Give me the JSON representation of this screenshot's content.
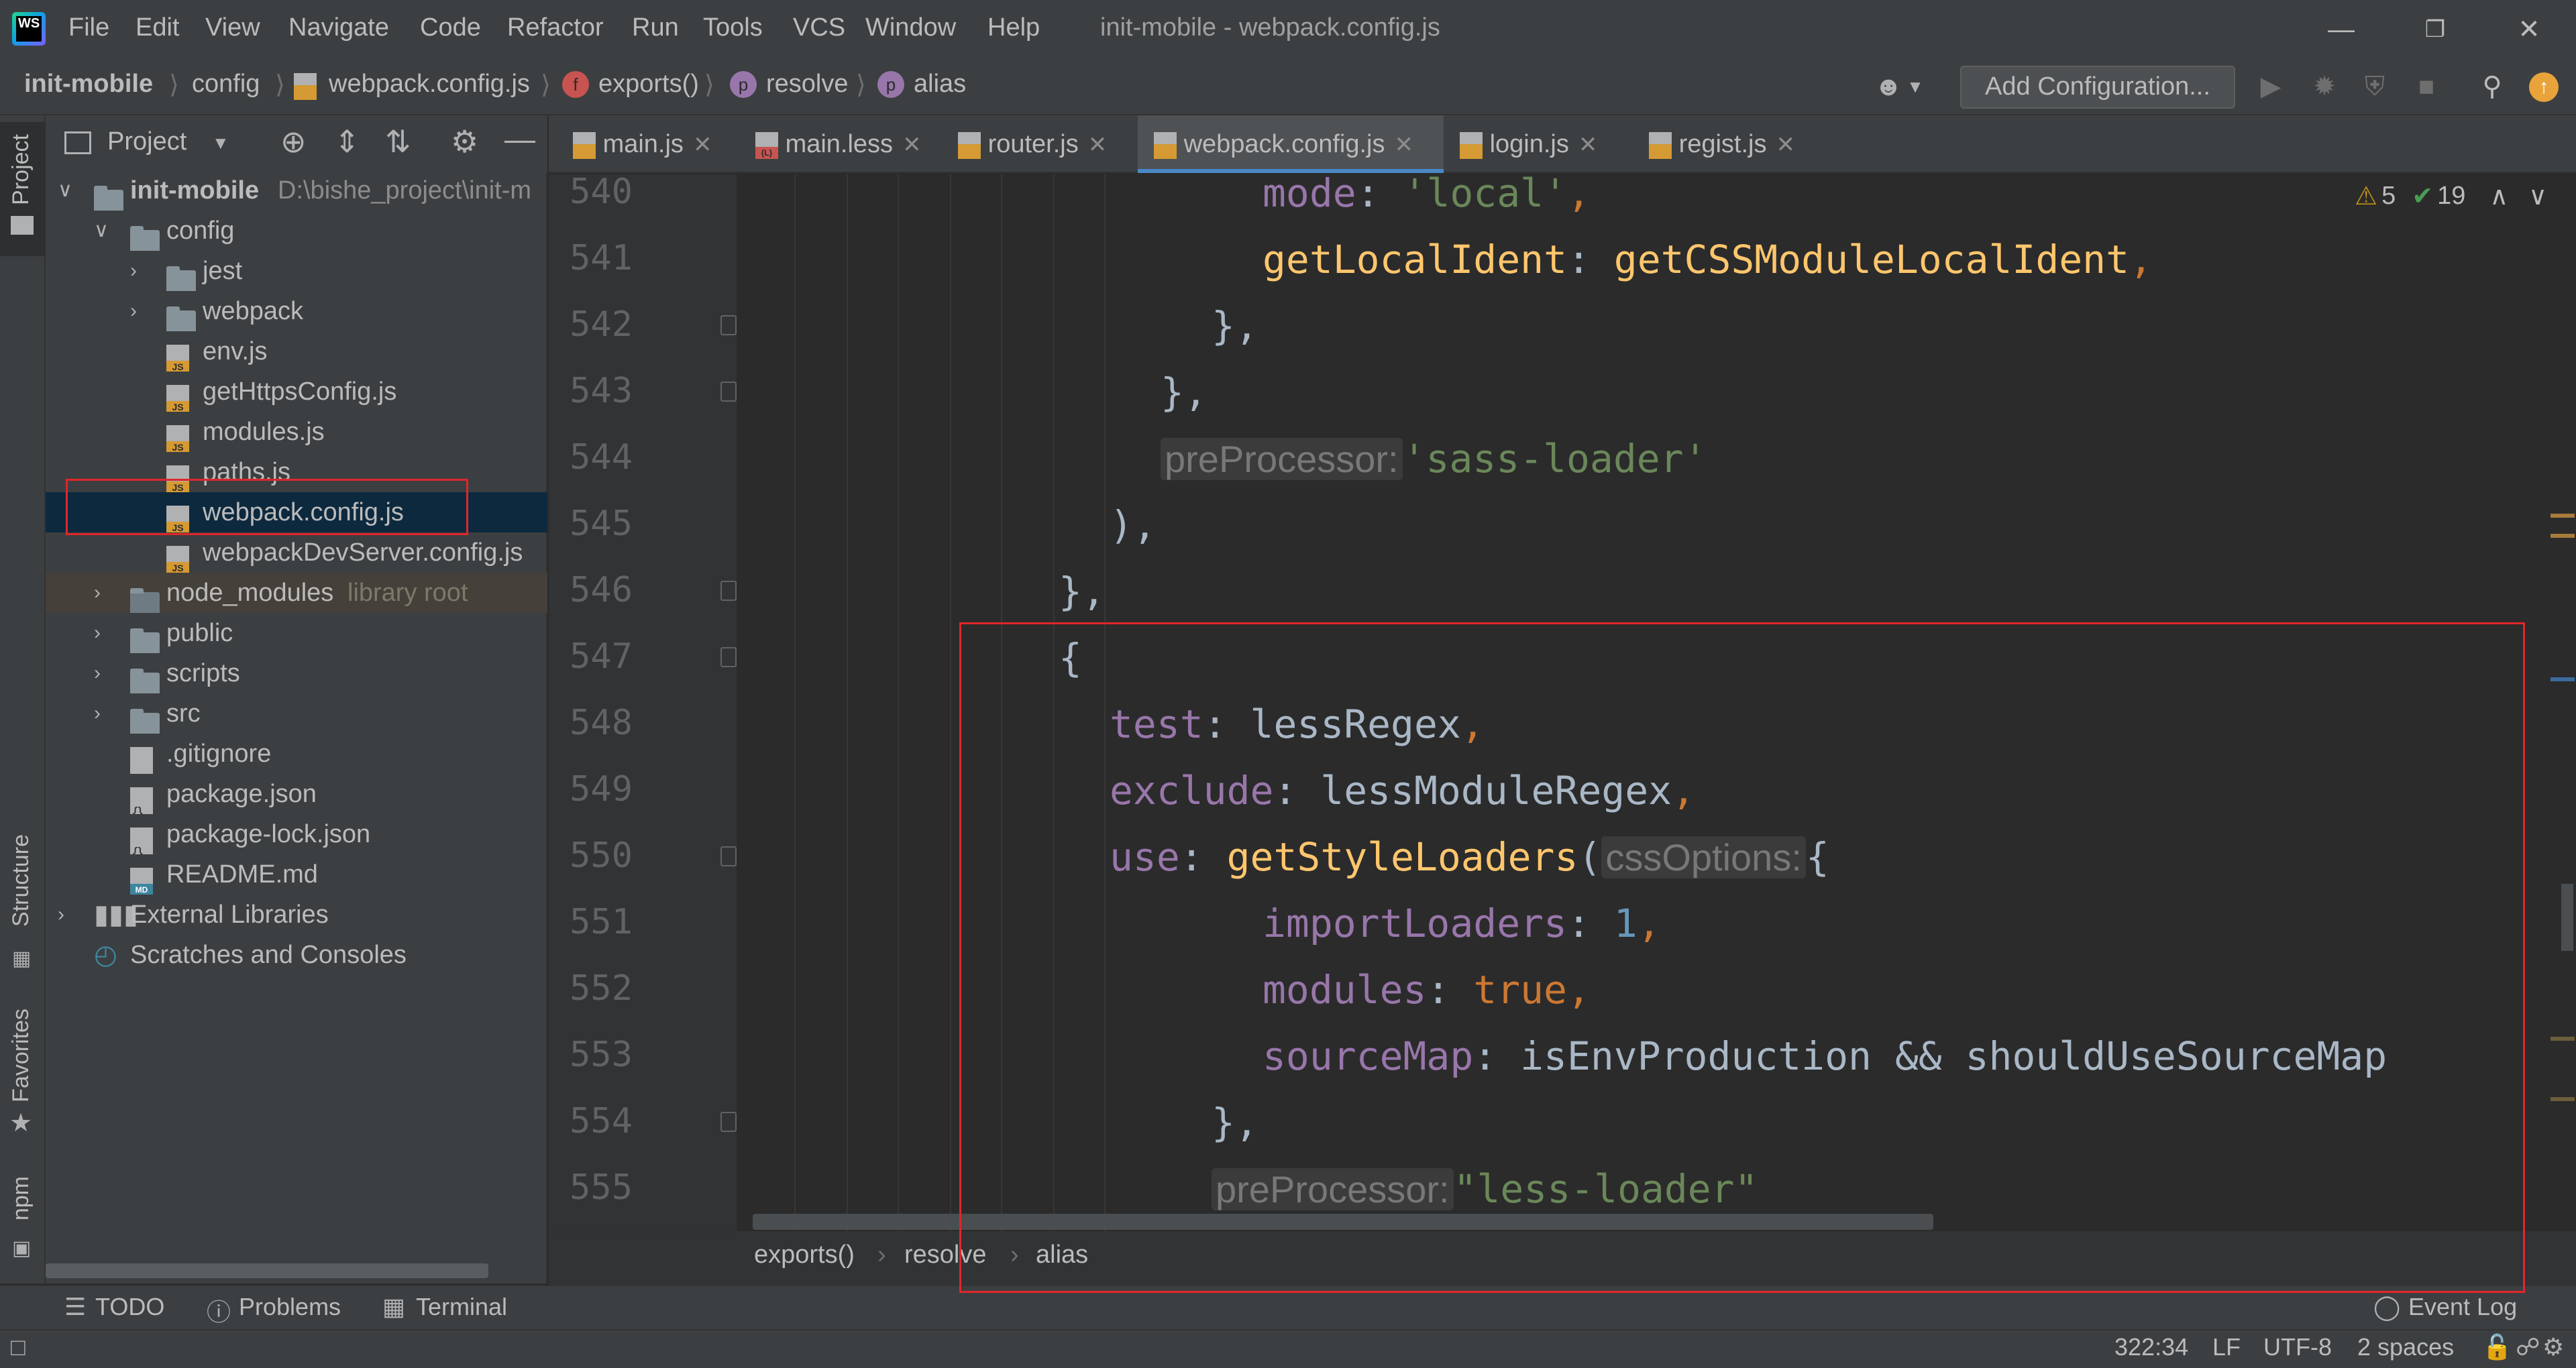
{
  "colors": {
    "accent": "#4A88C7",
    "annotation": "#E0262B",
    "keyword": "#CC7832",
    "property": "#9876AA",
    "string": "#6A8759",
    "function": "#FFC66D",
    "number": "#6897BB"
  },
  "menubar": {
    "items": [
      "File",
      "Edit",
      "View",
      "Navigate",
      "Code",
      "Refactor",
      "Run",
      "Tools",
      "VCS",
      "Window",
      "Help"
    ],
    "window_title": "init-mobile - webpack.config.js",
    "logo_text": "WS"
  },
  "navbar": {
    "crumbs": [
      "init-mobile",
      "config",
      "webpack.config.js",
      "exports()",
      "resolve",
      "alias"
    ],
    "func_badge": "f",
    "prop_badge": "p",
    "add_configuration": "Add Configuration..."
  },
  "left_strip": {
    "project": "Project",
    "structure": "Structure",
    "favorites": "Favorites",
    "npm": "npm"
  },
  "project_panel": {
    "title": "Project",
    "rows": [
      {
        "label": "init-mobile",
        "path": "D:\\bishe_project\\init-m"
      },
      {
        "label": "config"
      },
      {
        "label": "jest"
      },
      {
        "label": "webpack"
      },
      {
        "label": "env.js"
      },
      {
        "label": "getHttpsConfig.js"
      },
      {
        "label": "modules.js"
      },
      {
        "label": "paths.js"
      },
      {
        "label": "webpack.config.js"
      },
      {
        "label": "webpackDevServer.config.js"
      },
      {
        "label": "node_modules",
        "note": "library root"
      },
      {
        "label": "public"
      },
      {
        "label": "scripts"
      },
      {
        "label": "src"
      },
      {
        "label": ".gitignore"
      },
      {
        "label": "package.json"
      },
      {
        "label": "package-lock.json"
      },
      {
        "label": "README.md"
      },
      {
        "label": "External Libraries"
      },
      {
        "label": "Scratches and Consoles"
      }
    ]
  },
  "tabs": [
    "main.js",
    "main.less",
    "router.js",
    "webpack.config.js",
    "login.js",
    "regist.js"
  ],
  "active_tab": "webpack.config.js",
  "inspections": {
    "warnings": "5",
    "ok": "19"
  },
  "editor": {
    "line_numbers": [
      "540",
      "541",
      "542",
      "543",
      "544",
      "545",
      "546",
      "547",
      "548",
      "549",
      "550",
      "551",
      "552",
      "553",
      "554",
      "555"
    ],
    "l540": {
      "key": "mode",
      "value": "'local'"
    },
    "l541": {
      "key": "getLocalIdent",
      "value": "getCSSModuleLocalIdent"
    },
    "l542": "},",
    "l543": "},",
    "l544": {
      "hint": "preProcessor:",
      "value": "'sass-loader'"
    },
    "l545": "),",
    "l546": "},",
    "l547": "{",
    "l548": {
      "key": "test",
      "value": "lessRegex"
    },
    "l549": {
      "key": "exclude",
      "value": "lessModuleRegex"
    },
    "l550": {
      "key": "use",
      "fn": "getStyleLoaders",
      "hint": "cssOptions:",
      "tail": "{"
    },
    "l551": {
      "key": "importLoaders",
      "value": "1"
    },
    "l552": {
      "key": "modules",
      "value": "true"
    },
    "l553": {
      "key": "sourceMap",
      "value": "isEnvProduction && shouldUseSourceMap"
    },
    "l554": "},",
    "l555": {
      "hint": "preProcessor:",
      "value": "\"less-loader\""
    }
  },
  "breadcrumbs": [
    "exports()",
    "resolve",
    "alias"
  ],
  "bottom_tools": {
    "todo": "TODO",
    "problems": "Problems",
    "terminal": "Terminal",
    "event_log": "Event Log"
  },
  "status": {
    "position": "322:34",
    "line_sep": "LF",
    "encoding": "UTF-8",
    "indent": "2 spaces"
  }
}
